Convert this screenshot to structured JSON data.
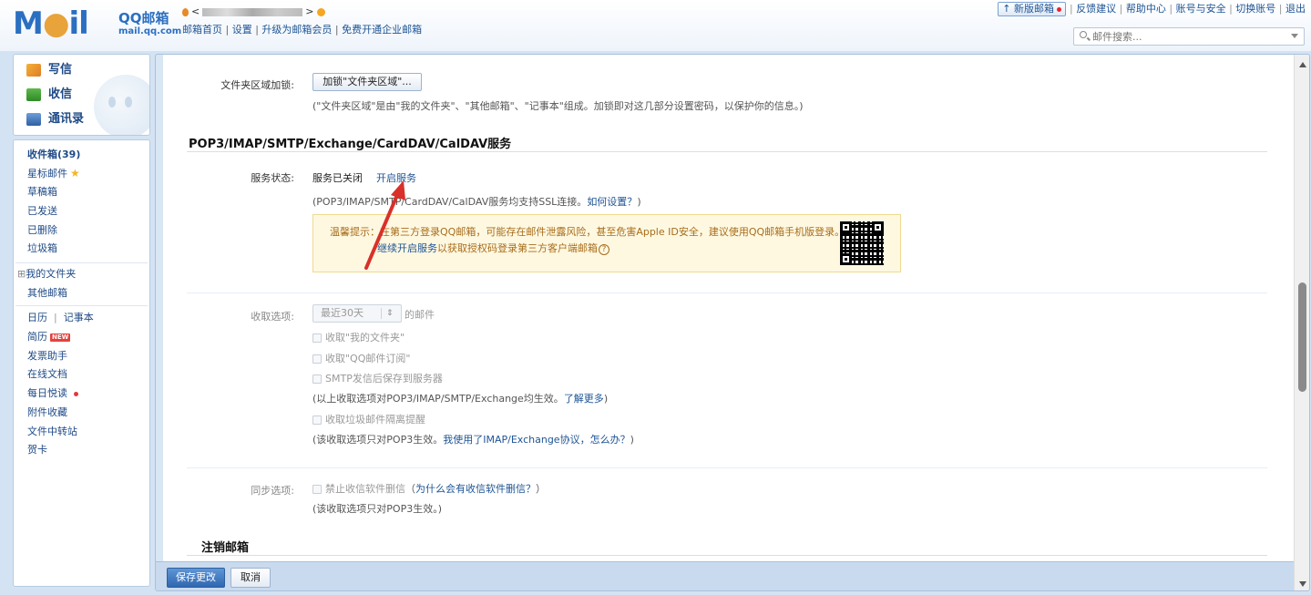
{
  "logo": {
    "main_a": "M",
    "main_o": "●",
    "main_b": "il",
    "qq": "QQ邮箱",
    "domain": "mail.qq.com"
  },
  "account": {
    "prefix": "<",
    "suffix": ">"
  },
  "topnav": {
    "home": "邮箱首页",
    "settings": "设置",
    "upgrade": "升级为邮箱会员",
    "enterprise": "免费开通企业邮箱"
  },
  "toplinks": {
    "newver": "新版邮箱",
    "feedback": "反馈建议",
    "help": "帮助中心",
    "security": "账号与安全",
    "switch": "切换账号",
    "logout": "退出"
  },
  "search": {
    "placeholder": "邮件搜索..."
  },
  "quick": {
    "write": "写信",
    "receive": "收信",
    "contacts": "通讯录"
  },
  "folders": {
    "inbox": "收件箱(39)",
    "starred": "星标邮件",
    "drafts": "草稿箱",
    "sent": "已发送",
    "deleted": "已删除",
    "spam": "垃圾箱",
    "my_folders": "我的文件夹",
    "other_mail": "其他邮箱",
    "calendar": "日历",
    "notes": "记事本",
    "resume": "简历",
    "resume_badge": "NEW",
    "invoice": "发票助手",
    "docs": "在线文档",
    "daily": "每日悦读",
    "attachments": "附件收藏",
    "transfer": "文件中转站",
    "cards": "贺卡"
  },
  "settings": {
    "lock_label": "文件夹区域加锁:",
    "lock_button": "加锁\"文件夹区域\"...",
    "lock_note": "(\"文件夹区域\"是由\"我的文件夹\"、\"其他邮箱\"、\"记事本\"组成。加锁即对这几部分设置密码，以保护你的信息。)",
    "section_title": "POP3/IMAP/SMTP/Exchange/CardDAV/CalDAV服务",
    "status_label": "服务状态:",
    "status_value": "服务已关闭",
    "enable_link": "开启服务",
    "ssl_note": "(POP3/IMAP/SMTP/CardDAV/CalDAV服务均支持SSL连接。",
    "how_link": "如何设置？",
    "ssl_close": ")",
    "tip_line1": "温馨提示：在第三方登录QQ邮箱，可能存在邮件泄露风险，甚至危害Apple ID安全，建议使用QQ邮箱手机版登录。",
    "tip_link": "继续开启服务",
    "tip_line2": "以获取授权码登录第三方客户端邮箱",
    "tip_help": "?",
    "receive_label": "收取选项:",
    "receive_select": "最近30天",
    "receive_suffix": "的邮件",
    "cb1": "收取\"我的文件夹\"",
    "cb2": "收取\"QQ邮件订阅\"",
    "cb3": "SMTP发信后保存到服务器",
    "note1_pre": "(以上收取选项对POP3/IMAP/SMTP/Exchange均生效。",
    "note1_link": "了解更多",
    "note1_post": ")",
    "cb4": "收取垃圾邮件隔离提醒",
    "note2_pre": "(该收取选项只对POP3生效。",
    "note2_link": "我使用了IMAP/Exchange协议，怎么办？",
    "note2_post": ")",
    "sync_label": "同步选项:",
    "cb5": "禁止收信软件删信",
    "cb5_link": "为什么会有收信软件删信？",
    "note3": "(该收取选项只对POP3生效。)",
    "cancel_title": "注销邮箱"
  },
  "footer": {
    "save": "保存更改",
    "cancel": "取消"
  }
}
